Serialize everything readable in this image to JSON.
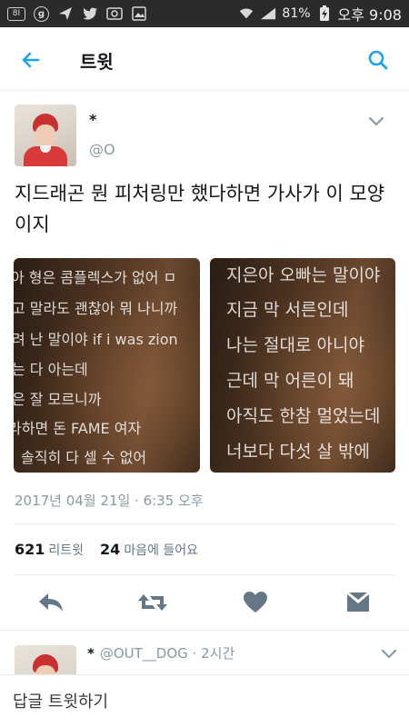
{
  "status_bar": {
    "notif_icons": [
      "sim-card-icon",
      "g-circle-icon",
      "send-icon",
      "twitter-bird-icon",
      "photo-icon",
      "image-icon"
    ],
    "wifi_icon": "wifi-icon",
    "signal_icon": "signal-icon",
    "battery_percent": "81%",
    "battery_icon": "battery-charging-icon",
    "time": "오후 9:08"
  },
  "header": {
    "title": "트윗",
    "back_icon": "arrow-left-icon",
    "search_icon": "search-icon"
  },
  "tweet": {
    "author_name": "*",
    "author_handle": "@O",
    "text": "지드래곤 뭔 피처링만 했다하면 가사가 이 모양이지",
    "media": [
      {
        "lines": [
          "아 형은 콤플렉스가 없어 ㅁ",
          "고 말라도 괜찮아 뭐 나니까",
          "려 난 말이야 if i was zion",
          "는 다 아는데",
          "은 잘 모르니까",
          "라하면 돈 FAME 여자",
          "솔직히 다 셀 수 없어"
        ]
      },
      {
        "lines": [
          "지은아 오빠는 말이야",
          "지금 막 서른인데",
          "나는 절대로 아니야",
          "근데 막 어른이 돼",
          "아직도 한참 멀었는데",
          "너보다 다섯 살 밖에"
        ]
      }
    ],
    "timestamp": "2017년 04월 21일 · 6:35 오후",
    "retweet_count": "621",
    "retweet_label": "리트윗",
    "like_count": "24",
    "like_label": "마음에 들어요"
  },
  "actions": {
    "reply_icon": "reply-icon",
    "retweet_icon": "retweet-icon",
    "like_icon": "heart-icon",
    "dm_icon": "mail-icon"
  },
  "reply_preview": {
    "name": "*",
    "handle": "@OUT__DOG",
    "time": "· 2시간"
  },
  "compose": {
    "placeholder": "답글 트윗하기"
  },
  "colors": {
    "accent": "#1da1f2",
    "muted": "#8899a6",
    "icon_gray": "#657786",
    "status_bar_bg": "#2b2b2b"
  }
}
